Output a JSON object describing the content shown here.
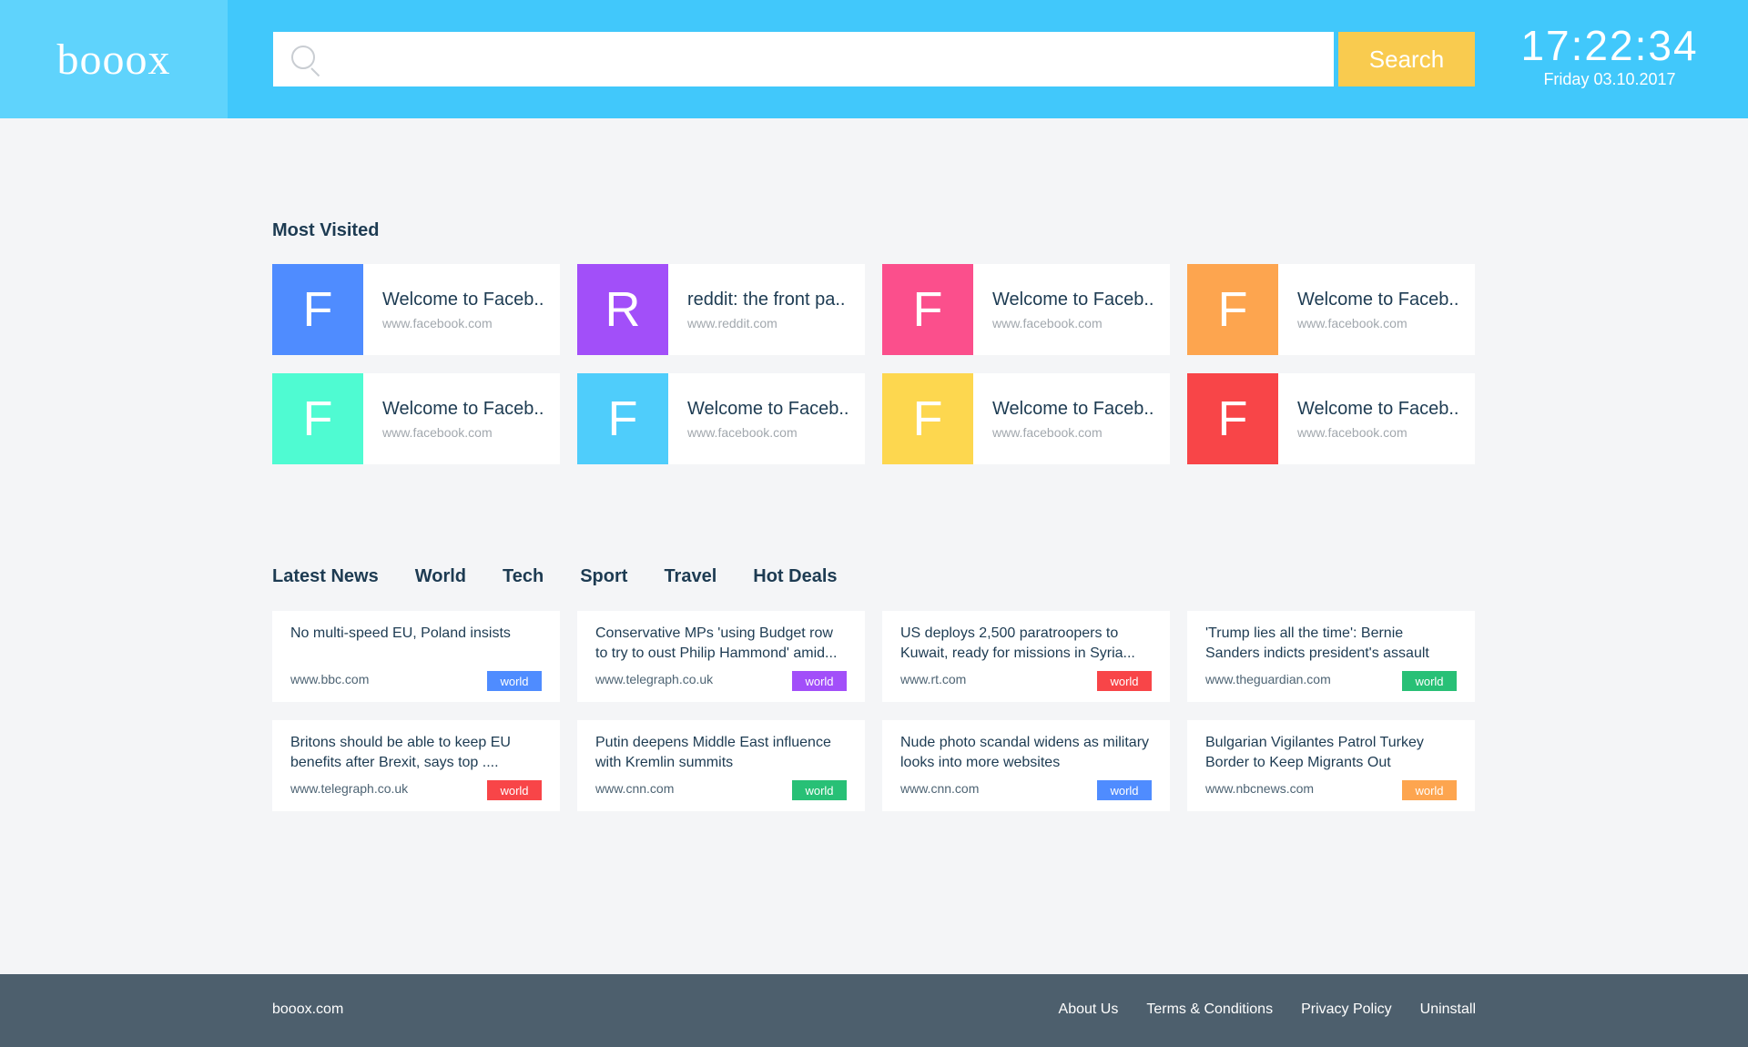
{
  "header": {
    "logo": "booox",
    "search": {
      "value": "",
      "placeholder": ""
    },
    "search_button": "Search",
    "clock_time": "17:22:34",
    "clock_date": "Friday 03.10.2017",
    "background": "#41c8fb"
  },
  "most_visited": {
    "title": "Most Visited",
    "items": [
      {
        "letter": "F",
        "title": "Welcome to Faceb..",
        "url": "www.facebook.com",
        "color": "#4f8cff"
      },
      {
        "letter": "R",
        "title": "reddit: the front pa..",
        "url": "www.reddit.com",
        "color": "#a24ff9"
      },
      {
        "letter": "F",
        "title": "Welcome to Faceb..",
        "url": "www.facebook.com",
        "color": "#fb4f8c"
      },
      {
        "letter": "F",
        "title": "Welcome to Faceb..",
        "url": "www.facebook.com",
        "color": "#fda54f"
      },
      {
        "letter": "F",
        "title": "Welcome to Faceb..",
        "url": "www.facebook.com",
        "color": "#4ffbd2"
      },
      {
        "letter": "F",
        "title": "Welcome to Faceb..",
        "url": "www.facebook.com",
        "color": "#4fcdfb"
      },
      {
        "letter": "F",
        "title": "Welcome to Faceb..",
        "url": "www.facebook.com",
        "color": "#fdd74f"
      },
      {
        "letter": "F",
        "title": "Welcome to Faceb..",
        "url": "www.facebook.com",
        "color": "#f84548"
      }
    ]
  },
  "news": {
    "tabs": [
      "Latest News",
      "World",
      "Tech",
      "Sport",
      "Travel",
      "Hot Deals"
    ],
    "items": [
      {
        "title": "No multi-speed EU, Poland insists",
        "url": "www.bbc.com",
        "tag": "world",
        "tag_color": "#4f8cff"
      },
      {
        "title": "Conservative MPs 'using Budget row to try to oust Philip Hammond' amid...",
        "url": "www.telegraph.co.uk",
        "tag": "world",
        "tag_color": "#a24ff9"
      },
      {
        "title": "US deploys 2,500 paratroopers to Kuwait, ready for missions in Syria...",
        "url": "www.rt.com",
        "tag": "world",
        "tag_color": "#f84548"
      },
      {
        "title": "'Trump lies all the time': Bernie Sanders indicts president's assault on....",
        "url": "www.theguardian.com",
        "tag": "world",
        "tag_color": "#28c076"
      },
      {
        "title": "Britons should be able to keep EU benefits after Brexit, says top ....",
        "url": "www.telegraph.co.uk",
        "tag": "world",
        "tag_color": "#f84548"
      },
      {
        "title": "Putin deepens Middle East influence with Kremlin summits",
        "url": "www.cnn.com",
        "tag": "world",
        "tag_color": "#28c076"
      },
      {
        "title": "Nude photo scandal widens as military looks into more websites",
        "url": "www.cnn.com",
        "tag": "world",
        "tag_color": "#4f8cff"
      },
      {
        "title": "Bulgarian Vigilantes Patrol Turkey Border to Keep Migrants Out",
        "url": "www.nbcnews.com",
        "tag": "world",
        "tag_color": "#fda54f"
      }
    ]
  },
  "footer": {
    "brand": "booox.com",
    "links": [
      "About Us",
      "Terms & Conditions",
      "Privacy Policy",
      "Uninstall"
    ]
  }
}
